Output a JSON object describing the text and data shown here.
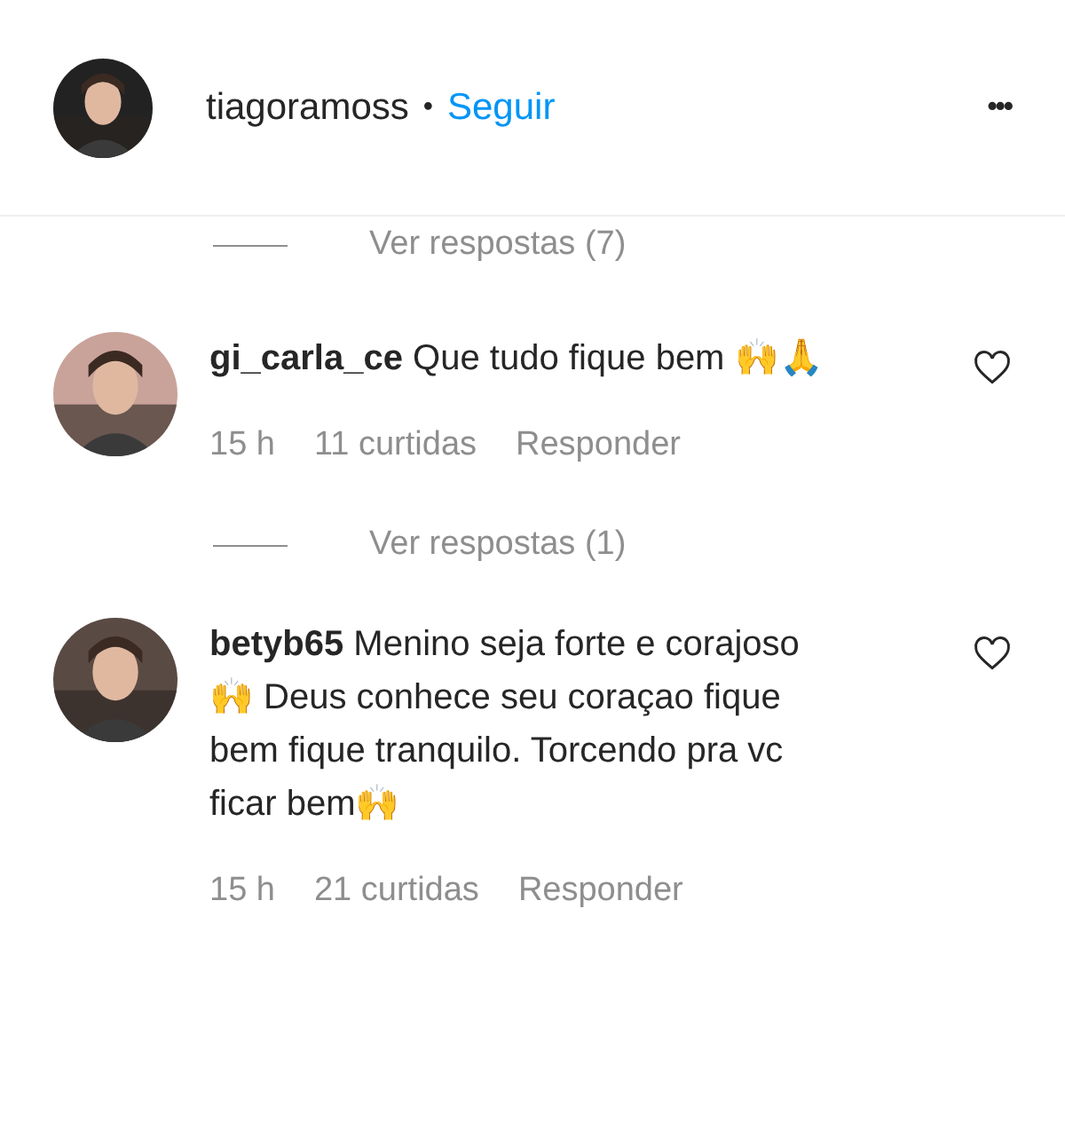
{
  "header": {
    "username": "tiagoramoss",
    "separator": "•",
    "follow": "Seguir",
    "more": "•••"
  },
  "top_replies": {
    "label": "Ver respostas (7)"
  },
  "comments": [
    {
      "username": "gi_carla_ce",
      "text": "Que tudo fique bem 🙌🙏",
      "time": "15 h",
      "likes": "11 curtidas",
      "reply": "Responder",
      "liked": false,
      "replies": "Ver respostas (1)"
    },
    {
      "username": "betyb65",
      "text": "Menino seja forte e corajoso🙌 Deus conhece seu coraçao fique bem fique tranquilo. Torcendo pra vc ficar bem🙌",
      "time": "15 h",
      "likes": "21 curtidas",
      "reply": "Responder",
      "liked": false
    }
  ]
}
